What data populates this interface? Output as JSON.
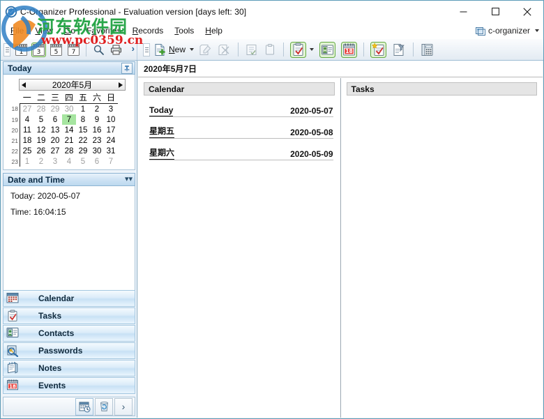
{
  "window": {
    "title": "C-Organizer Professional - Evaluation version [days left: 30]",
    "app_icon": "shield-check-icon",
    "minimize_label": "Minimize",
    "maximize_label": "Maximize",
    "close_label": "Close"
  },
  "menubar": {
    "items": [
      {
        "label": "File",
        "accel": "F"
      },
      {
        "label": "View",
        "accel": "V"
      },
      {
        "label": "Go",
        "accel": "G"
      },
      {
        "label": "Favorites",
        "accel": "a"
      },
      {
        "label": "Records",
        "accel": "R"
      },
      {
        "label": "Tools",
        "accel": "T"
      },
      {
        "label": "Help",
        "accel": "H"
      }
    ],
    "profile": {
      "label": "c-organizer",
      "icon": "database-icon"
    }
  },
  "toolbar": {
    "left_group": {
      "grip": "drag-grip",
      "day_buttons": [
        {
          "label": "1",
          "name": "view-1-day",
          "selected": false
        },
        {
          "label": "3",
          "name": "view-3-days",
          "selected": true
        },
        {
          "label": "5",
          "name": "view-5-days",
          "selected": false
        },
        {
          "label": "7",
          "name": "view-7-days",
          "selected": false
        }
      ],
      "search_icon": "magnifier-icon",
      "print_icon": "printer-icon",
      "overflow": "chevron-right-icon"
    },
    "main_group": {
      "new_label": "New",
      "new_icon": "new-document-icon",
      "edit_icon": "edit-record-icon",
      "delete_icon": "delete-record-icon",
      "checklist_icon": "checklist-icon",
      "clipboard_icon": "clipboard-icon",
      "task_icon": "task-clipboard-icon",
      "contact_icon": "contact-card-icon",
      "event_icon": "calendar-18-icon",
      "new_task_icon": "new-task-star-icon",
      "filter_icon": "document-filter-icon",
      "calculator_icon": "calculator-icon"
    }
  },
  "sidebar": {
    "today_panel": {
      "title": "Today",
      "pin_icon": "pushpin-icon",
      "calendar": {
        "prev_icon": "arrow-left-icon",
        "next_icon": "arrow-right-icon",
        "month_title": "2020年5月",
        "weekday_headers": [
          "一",
          "二",
          "三",
          "四",
          "五",
          "六",
          "日"
        ],
        "week_numbers": [
          "18",
          "19",
          "20",
          "21",
          "22",
          "23"
        ],
        "weeks": [
          [
            {
              "d": "27",
              "o": true
            },
            {
              "d": "28",
              "o": true
            },
            {
              "d": "29",
              "o": true
            },
            {
              "d": "30",
              "o": true
            },
            {
              "d": "1",
              "o": false
            },
            {
              "d": "2",
              "o": false
            },
            {
              "d": "3",
              "o": false
            }
          ],
          [
            {
              "d": "4",
              "o": false
            },
            {
              "d": "5",
              "o": false
            },
            {
              "d": "6",
              "o": false
            },
            {
              "d": "7",
              "o": false,
              "today": true
            },
            {
              "d": "8",
              "o": false
            },
            {
              "d": "9",
              "o": false
            },
            {
              "d": "10",
              "o": false
            }
          ],
          [
            {
              "d": "11",
              "o": false
            },
            {
              "d": "12",
              "o": false
            },
            {
              "d": "13",
              "o": false
            },
            {
              "d": "14",
              "o": false
            },
            {
              "d": "15",
              "o": false
            },
            {
              "d": "16",
              "o": false
            },
            {
              "d": "17",
              "o": false
            }
          ],
          [
            {
              "d": "18",
              "o": false
            },
            {
              "d": "19",
              "o": false
            },
            {
              "d": "20",
              "o": false
            },
            {
              "d": "21",
              "o": false
            },
            {
              "d": "22",
              "o": false
            },
            {
              "d": "23",
              "o": false
            },
            {
              "d": "24",
              "o": false
            }
          ],
          [
            {
              "d": "25",
              "o": false
            },
            {
              "d": "26",
              "o": false
            },
            {
              "d": "27",
              "o": false
            },
            {
              "d": "28",
              "o": false
            },
            {
              "d": "29",
              "o": false
            },
            {
              "d": "30",
              "o": false
            },
            {
              "d": "31",
              "o": false
            }
          ],
          [
            {
              "d": "1",
              "o": true
            },
            {
              "d": "2",
              "o": true
            },
            {
              "d": "3",
              "o": true
            },
            {
              "d": "4",
              "o": true
            },
            {
              "d": "5",
              "o": true
            },
            {
              "d": "6",
              "o": true
            },
            {
              "d": "7",
              "o": true
            }
          ]
        ]
      }
    },
    "datetime_panel": {
      "title": "Date and Time",
      "collapse_icon": "chevron-double-down-icon",
      "today_line": "Today: 2020-05-07",
      "time_line": "Time: 16:04:15"
    },
    "nav_items": [
      {
        "label": "Calendar",
        "icon": "calendar-icon"
      },
      {
        "label": "Tasks",
        "icon": "task-clipboard-icon"
      },
      {
        "label": "Contacts",
        "icon": "contact-card-icon"
      },
      {
        "label": "Passwords",
        "icon": "key-magnifier-icon"
      },
      {
        "label": "Notes",
        "icon": "notepad-icon"
      },
      {
        "label": "Events",
        "icon": "calendar-18-icon"
      }
    ],
    "nav_footer": {
      "schedule_icon": "calendar-clock-icon",
      "recycle_icon": "recycle-bin-icon",
      "expand_icon": "chevron-right-icon"
    }
  },
  "main": {
    "header_date": "2020年5月7日",
    "calendar_section": {
      "title": "Calendar",
      "rows": [
        {
          "label": "Today",
          "date": "2020-05-07"
        },
        {
          "label": "星期五",
          "date": "2020-05-08"
        },
        {
          "label": "星期六",
          "date": "2020-05-09"
        }
      ]
    },
    "tasks_section": {
      "title": "Tasks",
      "rows": []
    }
  },
  "watermark": {
    "chinese": "河东软件园",
    "url": "www.pc0359.cn"
  },
  "colors": {
    "accent": "#5b9bb8",
    "today_highlight": "#a6e5a0",
    "panel_header": "#bcd9ef",
    "section_header": "#e5e5e5",
    "watermark_green": "#2aa64a",
    "watermark_red": "#e02020"
  }
}
